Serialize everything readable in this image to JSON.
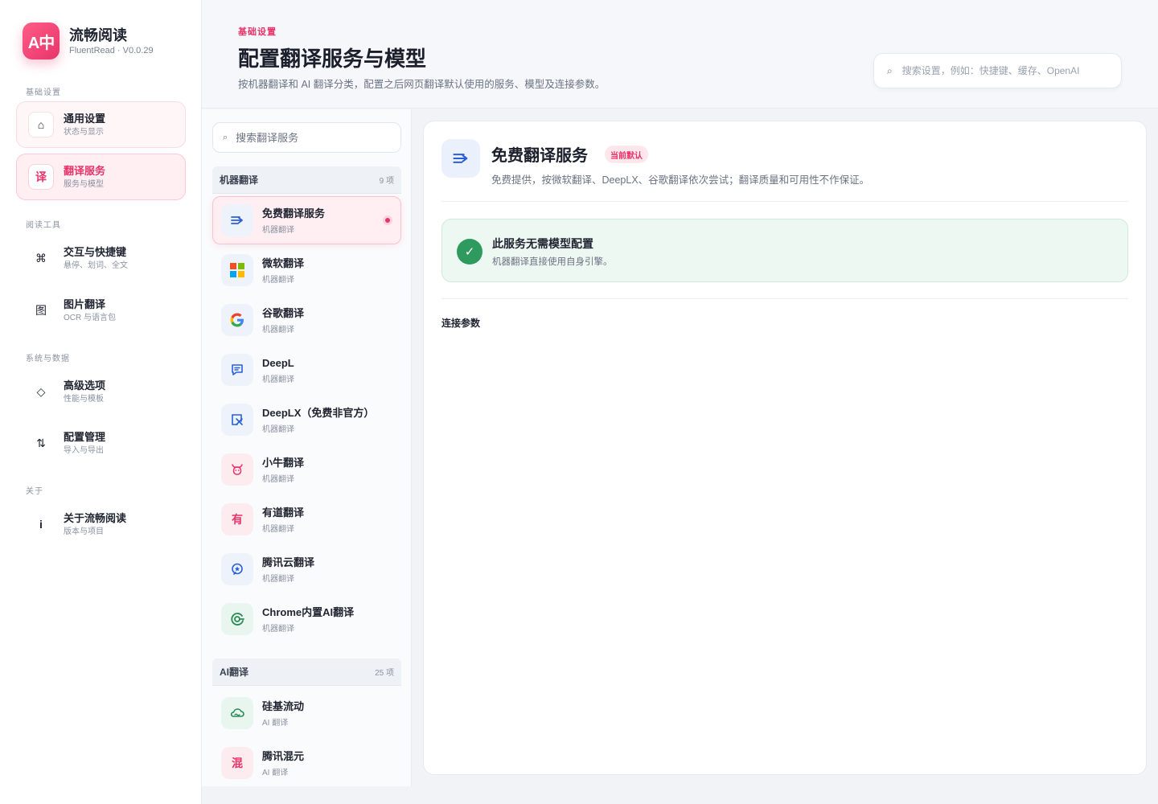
{
  "brand": {
    "logo": "A中",
    "name": "流畅阅读",
    "version": "FluentRead · V0.0.29"
  },
  "sidebar": {
    "groups": [
      {
        "label": "基础设置"
      },
      {
        "label": "阅读工具"
      },
      {
        "label": "系统与数据"
      },
      {
        "label": "关于"
      }
    ],
    "items": [
      {
        "icon": "home-icon",
        "glyph": "⌂",
        "title": "通用设置",
        "sub": "状态与显示"
      },
      {
        "icon": "translate-char-icon",
        "glyph": "译",
        "title": "翻译服务",
        "sub": "服务与模型"
      },
      {
        "icon": "command-icon",
        "glyph": "⌘",
        "title": "交互与快捷键",
        "sub": "悬停、划词、全文"
      },
      {
        "icon": "image-char-icon",
        "glyph": "图",
        "title": "图片翻译",
        "sub": "OCR 与语言包"
      },
      {
        "icon": "diamond-icon",
        "glyph": "◇",
        "title": "高级选项",
        "sub": "性能与模板"
      },
      {
        "icon": "swap-arrows-icon",
        "glyph": "⇅",
        "title": "配置管理",
        "sub": "导入与导出"
      },
      {
        "icon": "info-icon",
        "glyph": "i",
        "title": "关于流畅阅读",
        "sub": "版本与项目"
      }
    ]
  },
  "header": {
    "eyebrow": "基础设置",
    "title": "配置翻译服务与模型",
    "desc": "按机器翻译和 AI 翻译分类，配置之后网页翻译默认使用的服务、模型及连接参数。",
    "search_placeholder": "搜索设置，例如：快捷键、缓存、OpenAI"
  },
  "service_list": {
    "search_placeholder": "搜索翻译服务",
    "machine": {
      "name": "机器翻译",
      "count": "9 项",
      "items": [
        {
          "name": "免费翻译服务",
          "sub": "机器翻译"
        },
        {
          "name": "微软翻译",
          "sub": "机器翻译"
        },
        {
          "name": "谷歌翻译",
          "sub": "机器翻译"
        },
        {
          "name": "DeepL",
          "sub": "机器翻译"
        },
        {
          "name": "DeepLX（免费非官方）",
          "sub": "机器翻译"
        },
        {
          "name": "小牛翻译",
          "sub": "机器翻译"
        },
        {
          "name": "有道翻译",
          "sub": "机器翻译",
          "glyph": "有"
        },
        {
          "name": "腾讯云翻译",
          "sub": "机器翻译"
        },
        {
          "name": "Chrome内置AI翻译",
          "sub": "机器翻译"
        }
      ]
    },
    "ai": {
      "name": "AI翻译",
      "count": "25 项",
      "items": [
        {
          "name": "硅基流动",
          "sub": "AI 翻译"
        },
        {
          "name": "腾讯混元",
          "sub": "AI 翻译",
          "glyph": "混"
        }
      ]
    }
  },
  "detail": {
    "title": "免费翻译服务",
    "badge": "当前默认",
    "desc": "免费提供，按微软翻译、DeepLX、谷歌翻译依次尝试；翻译质量和可用性不作保证。",
    "notice": {
      "icon": "check-icon",
      "glyph": "✓",
      "title": "此服务无需模型配置",
      "sub": "机器翻译直接使用自身引擎。"
    },
    "section": "连接参数"
  },
  "colors": {
    "accent": "#e8346a",
    "success": "#2f9a5e",
    "link_blue": "#2b5fd9"
  }
}
